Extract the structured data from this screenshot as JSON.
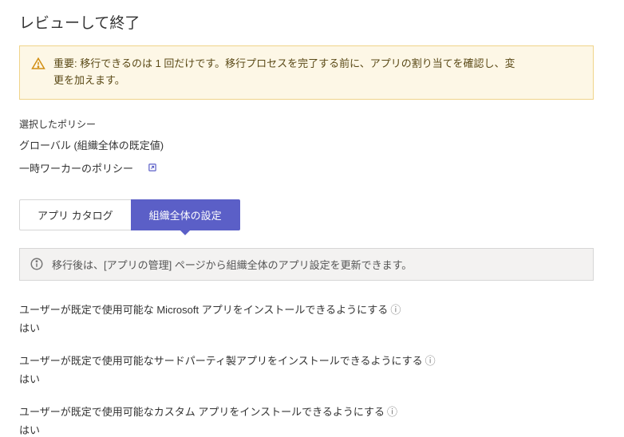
{
  "title": "レビューして終了",
  "warning": {
    "text": "重要: 移行できるのは 1 回だけです。移行プロセスを完了する前に、アプリの割り当てを確認し、変更を加えます。"
  },
  "policies": {
    "label": "選択したポリシー",
    "global": "グローバル (組織全体の既定値)",
    "temp_worker": "一時ワーカーのポリシー"
  },
  "tabs": {
    "catalog": "アプリ カタログ",
    "org_settings": "組織全体の設定"
  },
  "info_bar": "移行後は、[アプリの管理] ページから組織全体のアプリ設定を更新できます。",
  "info_suffix": "ⓘ",
  "settings": [
    {
      "label": "ユーザーが既定で使用可能な Microsoft アプリをインストールできるようにする",
      "value": "はい"
    },
    {
      "label": "ユーザーが既定で使用可能なサードパーティ製アプリをインストールできるようにする",
      "value": "はい"
    },
    {
      "label": "ユーザーが既定で使用可能なカスタム アプリをインストールできるようにする",
      "value": "はい"
    }
  ]
}
